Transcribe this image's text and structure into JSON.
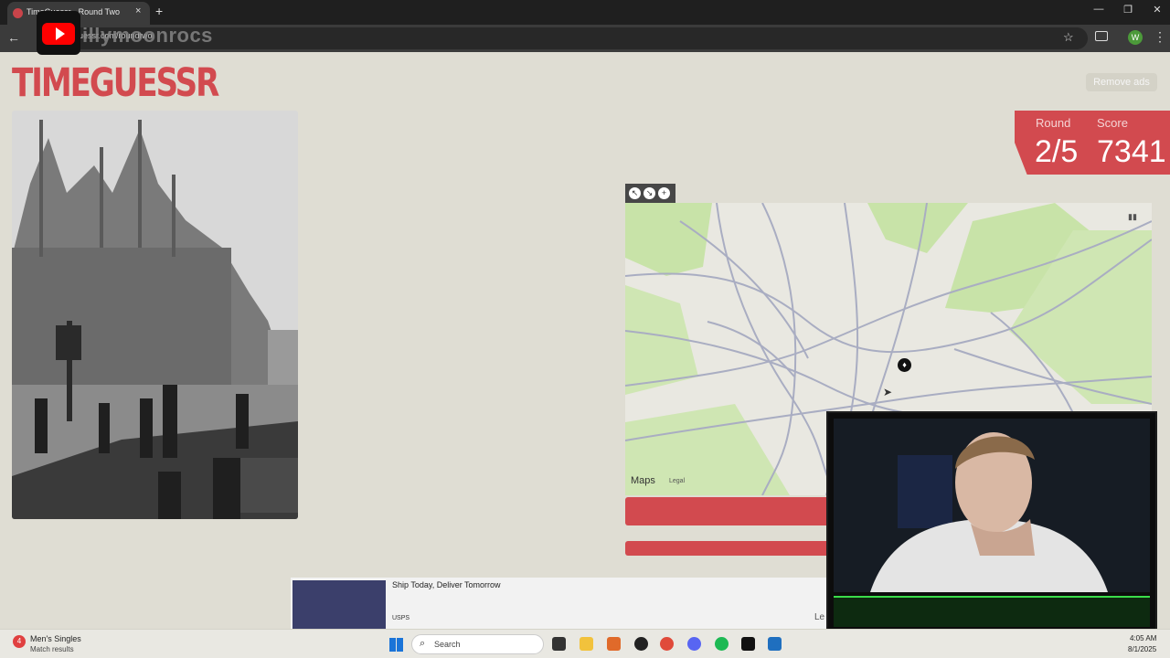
{
  "browser": {
    "tab_title": "TimeGuessr - Round Two",
    "tab_close": "×",
    "new_tab": "+",
    "url": "timeguessr.com/roundtwo",
    "back": "←",
    "star": "☆",
    "menu": "⋮",
    "profile_initial": "W",
    "window_controls": [
      "—",
      "❐",
      "✕"
    ]
  },
  "overlay": {
    "channel": "illymoonrocs"
  },
  "page": {
    "logo": "TIMEGUESSR",
    "remove_ads": "Remove ads",
    "round_label": "Round",
    "score_label": "Score",
    "round_value": "2/5",
    "score_value": "7341"
  },
  "map": {
    "attribution": "Maps",
    "legal": "Legal",
    "controls": [
      "↖",
      "↘",
      "+"
    ]
  },
  "ad": {
    "title": "Ship Today, Deliver Tomorrow",
    "brand": "USPS",
    "cta": "Le"
  },
  "taskbar": {
    "news_badge": "4",
    "news_title": "Men's Singles",
    "news_sub": "Match results",
    "search_placeholder": "Search",
    "time": "4:05 AM",
    "date": "8/1/2025"
  },
  "colors": {
    "brand_red": "#d24a4f",
    "page_bg": "#dfddd3",
    "webcam_accent": "#3bdc4a"
  }
}
